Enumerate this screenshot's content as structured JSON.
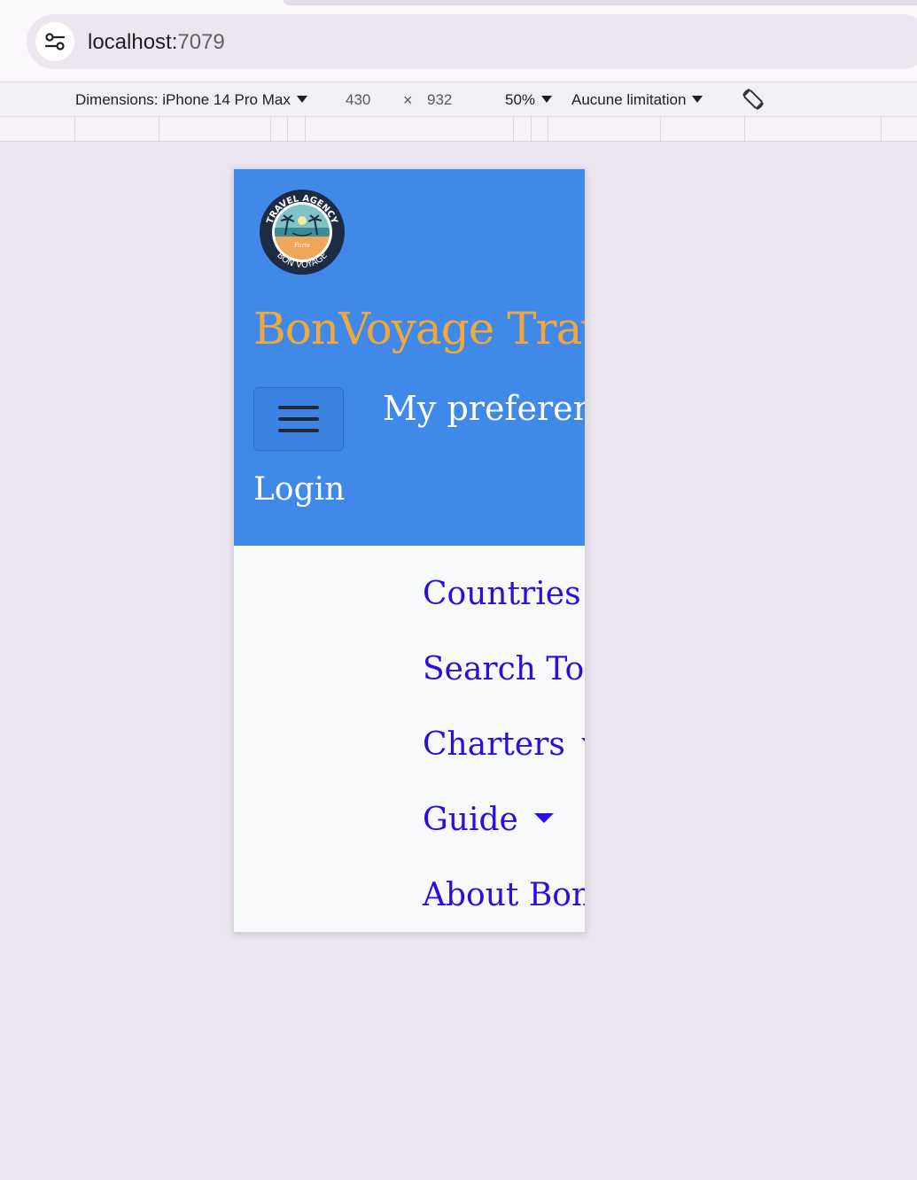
{
  "browser": {
    "url_host": "localhost:",
    "url_port": "7079"
  },
  "devtools": {
    "dimensions_label": "Dimensions: iPhone 14 Pro Max",
    "width_value": "430",
    "times": "×",
    "height_value": "932",
    "zoom": "50%",
    "throttling": "Aucune limitation"
  },
  "site": {
    "logo_text": {
      "top": "TRAVEL AGENCY",
      "bottom": "BON VOYAGE",
      "center": "Paris"
    },
    "brand": "BonVoyage Travel",
    "preferences_link": "My preferences",
    "login_link": "Login",
    "nav": [
      {
        "label": "Countries",
        "dropdown": false
      },
      {
        "label": "Search Tours",
        "dropdown": false
      },
      {
        "label": "Charters",
        "dropdown": true
      },
      {
        "label": "Guide",
        "dropdown": true
      },
      {
        "label": "About BonVoyage",
        "dropdown": false
      }
    ]
  },
  "colors": {
    "header_bg": "#4189e8",
    "brand": "#f0a83c",
    "nav_link": "#2a0ee0",
    "nav_bg": "#f8f9fa"
  }
}
